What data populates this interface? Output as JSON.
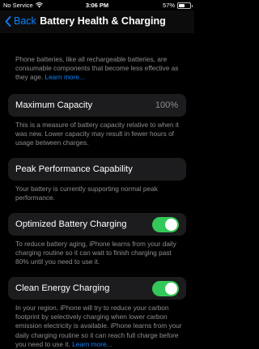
{
  "status_bar": {
    "carrier": "No Service",
    "time": "3:06 PM",
    "battery_percent_label": "57%",
    "battery_level": 0.57
  },
  "nav": {
    "back_label": "Back",
    "title": "Battery Health & Charging"
  },
  "intro": {
    "text": "Phone batteries, like all rechargeable batteries, are consumable components that become less effective as they age.",
    "link": "Learn more..."
  },
  "maximum_capacity": {
    "label": "Maximum Capacity",
    "value": "100%",
    "footer": "This is a measure of battery capacity relative to when it was new. Lower capacity may result in fewer hours of usage between charges."
  },
  "peak_performance": {
    "label": "Peak Performance Capability",
    "footer": "Your battery is currently supporting normal peak performance."
  },
  "optimized_charging": {
    "label": "Optimized Battery Charging",
    "enabled": true,
    "footer": "To reduce battery aging, iPhone learns from your daily charging routine so it can wait to finish charging past 80% until you need to use it."
  },
  "clean_energy": {
    "label": "Clean Energy Charging",
    "enabled": true,
    "footer": "In your region, iPhone will try to reduce your carbon footprint by selectively charging when lower carbon emission electricity is available. iPhone learns from your daily charging routine so it can reach full charge before you need to use it.",
    "link": "Learn more..."
  },
  "colors": {
    "accent": "#0a84ff",
    "toggle_on": "#34c759",
    "cell_background": "#1c1c1e",
    "secondary_text": "#8e8e93"
  }
}
